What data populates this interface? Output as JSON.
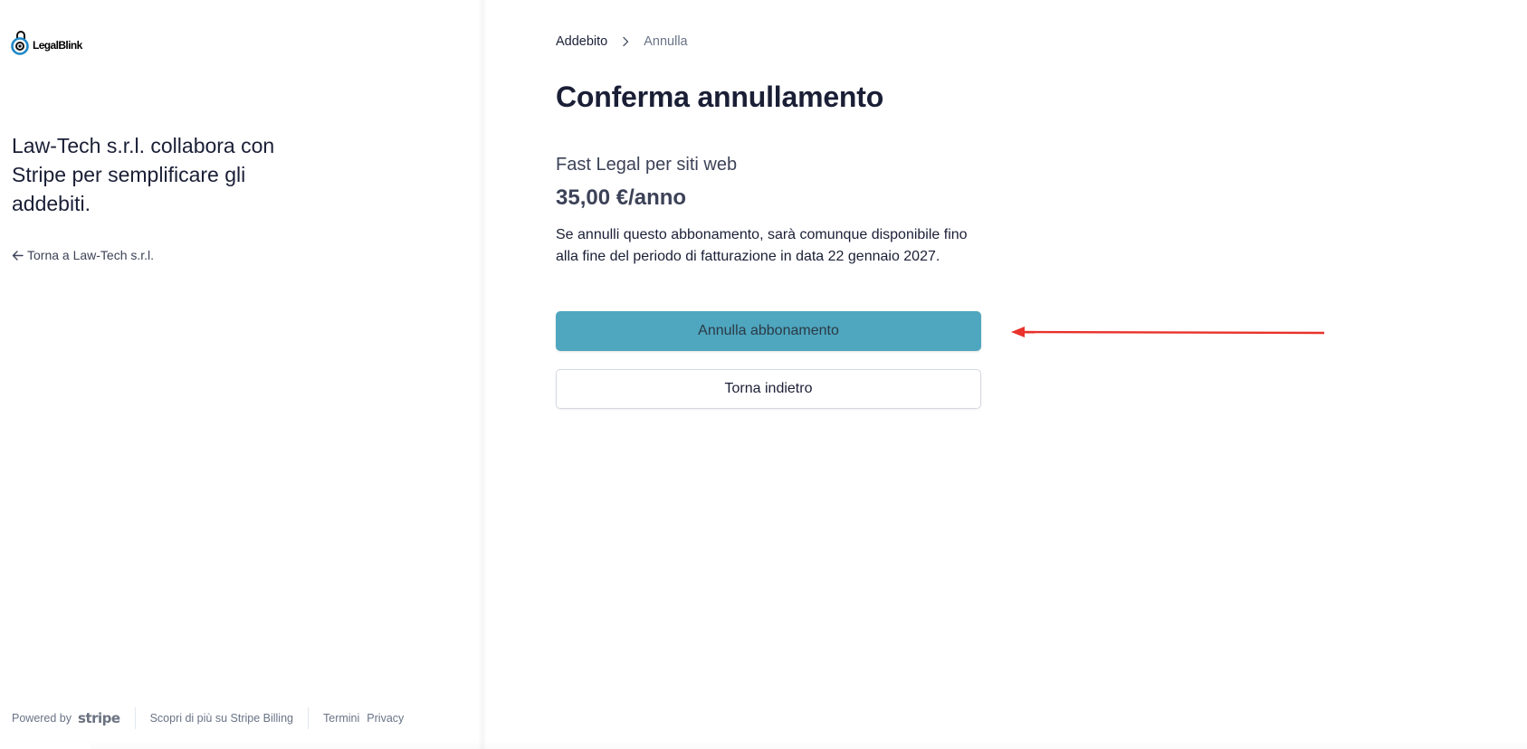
{
  "logo": {
    "text": "LegalBlink"
  },
  "left": {
    "merchant_text": "Law-Tech s.r.l. collabora con Stripe per semplificare gli addebiti.",
    "back_link": "Torna a Law-Tech s.r.l."
  },
  "footer": {
    "powered_by": "Powered by",
    "stripe": "stripe",
    "learn_more": "Scopri di più su Stripe Billing",
    "terms": "Termini",
    "privacy": "Privacy"
  },
  "breadcrumb": {
    "item1": "Addebito",
    "item2": "Annulla"
  },
  "main": {
    "title": "Conferma annullamento",
    "product_name": "Fast Legal per siti web",
    "price": "35,00 €/anno",
    "description": "Se annulli questo abbonamento, sarà comunque disponibile fino alla fine del periodo di fatturazione in data 22 gennaio 2027.",
    "cancel_button": "Annulla abbonamento",
    "back_button": "Torna indietro"
  },
  "colors": {
    "accent": "#4fa6bf",
    "annotation_arrow": "#e8322b",
    "text_primary": "#1a1f36",
    "text_secondary": "#697386"
  },
  "icons": [
    "legalblink-logo-icon",
    "arrow-left-icon",
    "chevron-right-icon",
    "annotation-arrow-icon"
  ]
}
